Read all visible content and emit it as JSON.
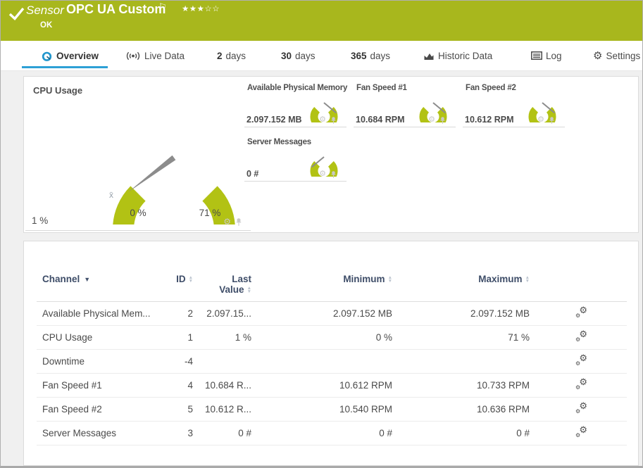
{
  "header": {
    "sensor_label": "Sensor",
    "sensor_name": "OPC UA Custom",
    "status": "OK",
    "stars_filled": "★★★",
    "stars_empty": "☆☆"
  },
  "icons": {
    "flag": "⚐",
    "gear": "⚙",
    "sort_up": "▲",
    "sort_down": "▼",
    "sort_desc": "▼"
  },
  "tabs": {
    "overview": {
      "label": "Overview"
    },
    "live_data": {
      "label": "Live Data"
    },
    "days2": {
      "number": "2",
      "label": "days"
    },
    "days30": {
      "number": "30",
      "label": "days"
    },
    "days365": {
      "number": "365",
      "label": "days"
    },
    "historic": {
      "label": "Historic Data"
    },
    "log": {
      "label": "Log"
    },
    "settings": {
      "label": "Settings"
    }
  },
  "gauges": {
    "cpu": {
      "title": "CPU Usage",
      "current": "1 %",
      "scale_min": "0 %",
      "scale_max": "71 %",
      "avg_marker": "x̄"
    },
    "minis": [
      {
        "title": "Available Physical Memory",
        "value": "2.097.152 MB",
        "needle": "high"
      },
      {
        "title": "Fan Speed #1",
        "value": "10.684 RPM",
        "needle": "high"
      },
      {
        "title": "Fan Speed #2",
        "value": "10.612 RPM",
        "needle": "high"
      },
      {
        "title": "Server Messages",
        "value": "0 #",
        "needle": "low"
      }
    ]
  },
  "table": {
    "col_channel": "Channel",
    "col_id": "ID",
    "col_last_line1": "Last",
    "col_last_line2": "Value",
    "col_min": "Minimum",
    "col_max": "Maximum",
    "rows": [
      {
        "channel": "Available Physical Mem...",
        "id": "2",
        "last": "2.097.15...",
        "min": "2.097.152 MB",
        "max": "2.097.152 MB"
      },
      {
        "channel": "CPU Usage",
        "id": "1",
        "last": "1 %",
        "min": "0 %",
        "max": "71 %"
      },
      {
        "channel": "Downtime",
        "id": "-4",
        "last": "",
        "min": "",
        "max": ""
      },
      {
        "channel": "Fan Speed #1",
        "id": "4",
        "last": "10.684 R...",
        "min": "10.612 RPM",
        "max": "10.733 RPM"
      },
      {
        "channel": "Fan Speed #2",
        "id": "5",
        "last": "10.612 R...",
        "min": "10.540 RPM",
        "max": "10.636 RPM"
      },
      {
        "channel": "Server Messages",
        "id": "3",
        "last": "0 #",
        "min": "0 #",
        "max": "0 #"
      }
    ]
  },
  "colors": {
    "status_ok_green": "#a8b71d",
    "gauge_green": "#b2c214",
    "accent_blue": "#2da0d6"
  }
}
